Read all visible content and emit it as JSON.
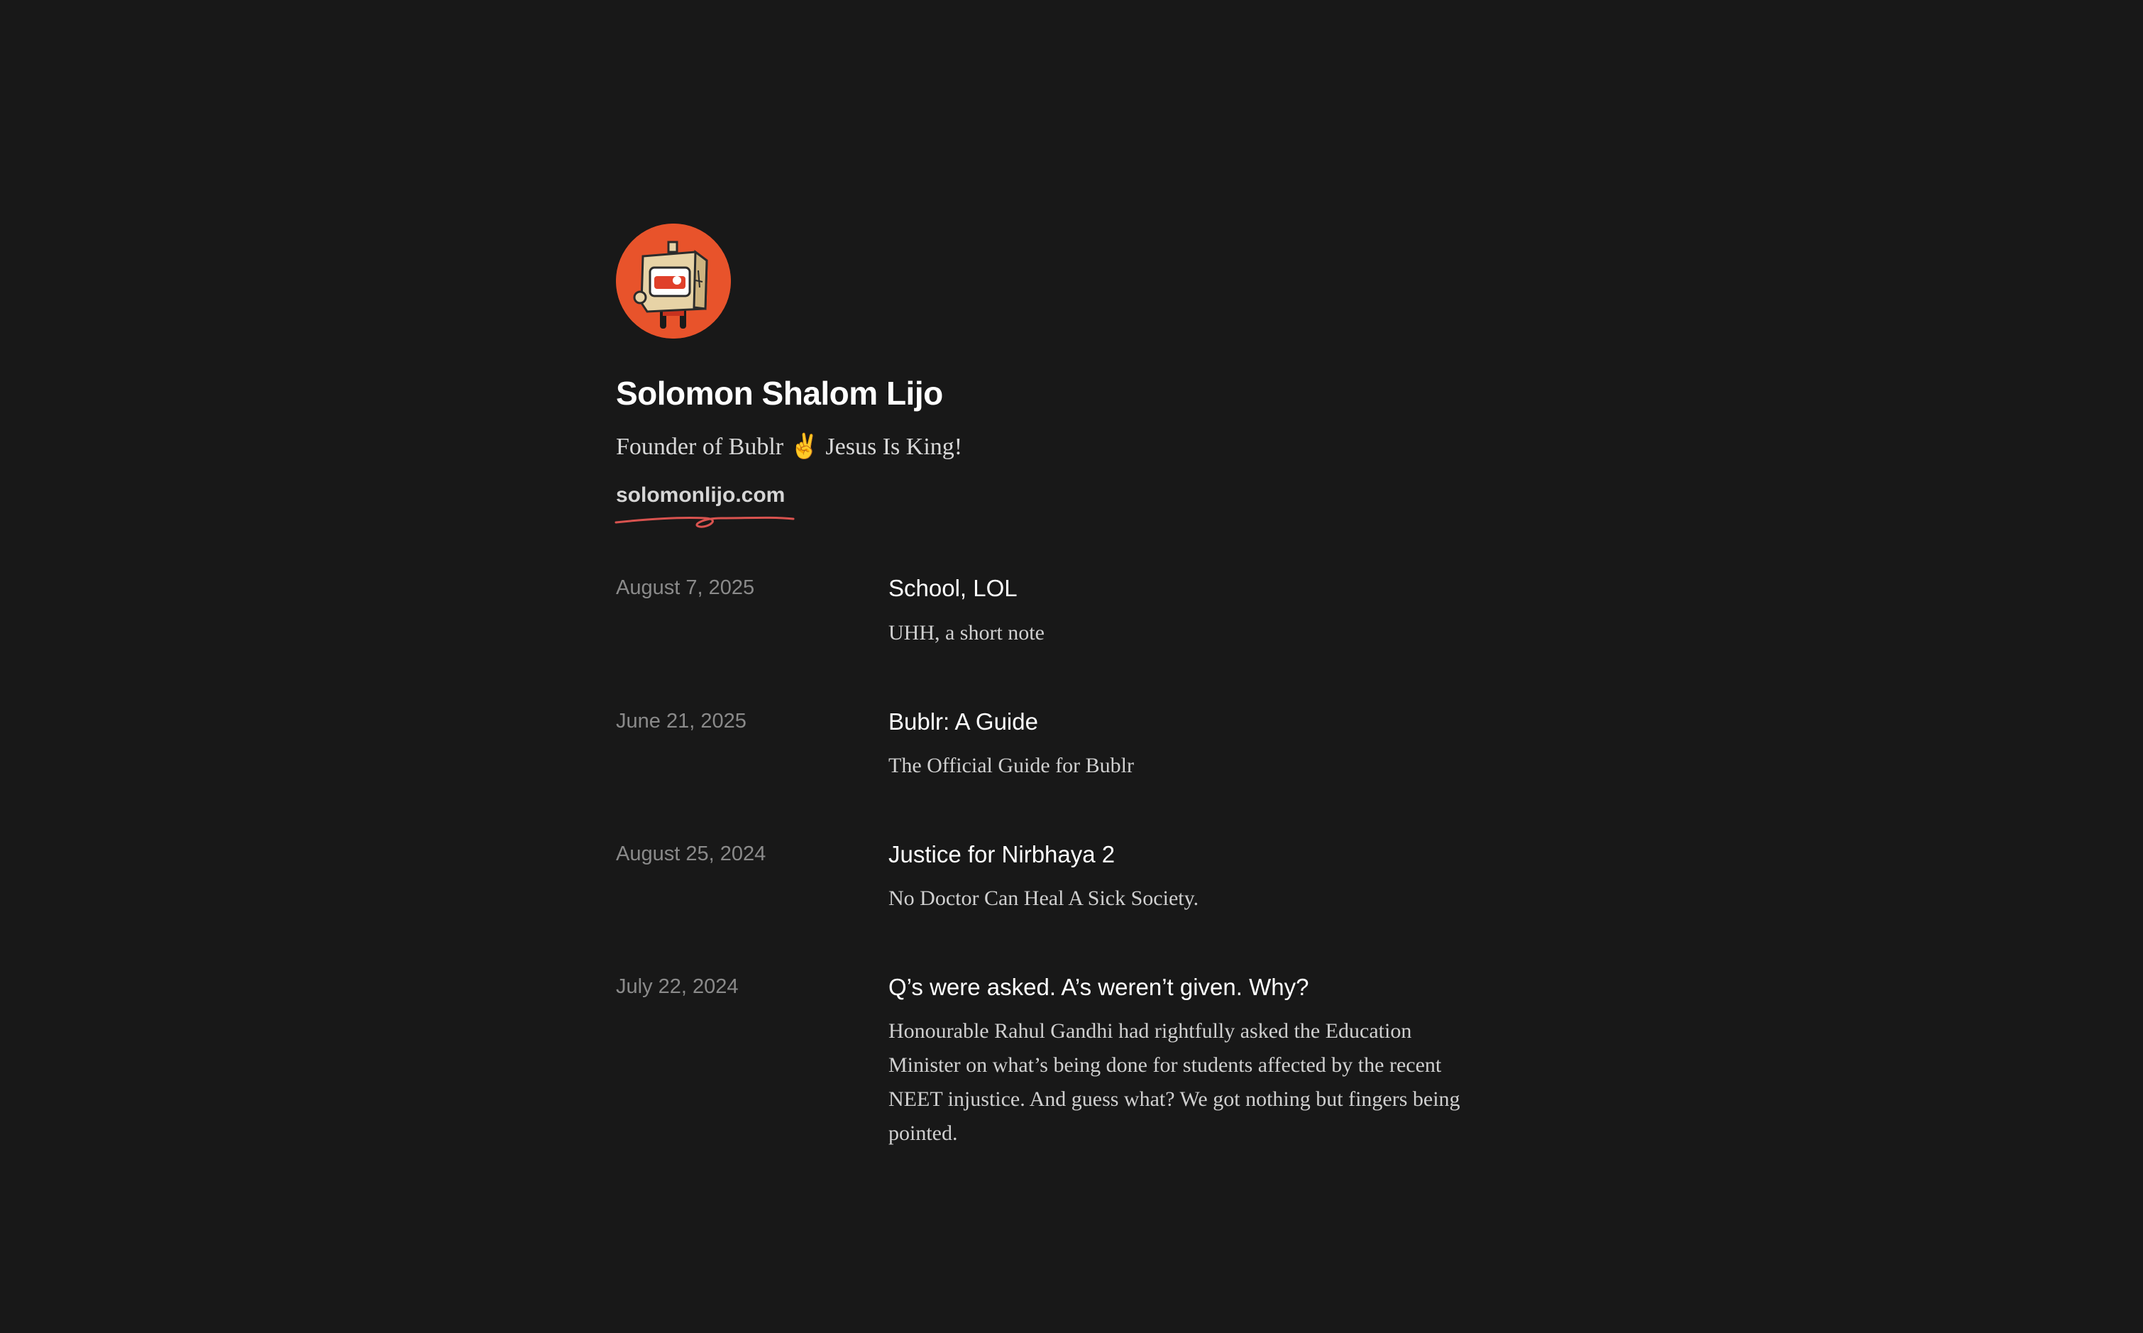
{
  "profile": {
    "name": "Solomon Shalom Lijo",
    "bio": "Founder of Bublr ✌️ Jesus Is King!",
    "website": "solomonlijo.com",
    "avatar_icon": "robot-box-avatar-icon"
  },
  "colors": {
    "background": "#181818",
    "avatar_bg": "#e8532b",
    "scribble": "#d9534f",
    "date": "#8a8a8a",
    "text": "#ffffff"
  },
  "posts": [
    {
      "date": "August 7, 2025",
      "title": "School, LOL",
      "description": "UHH, a short note"
    },
    {
      "date": "June 21, 2025",
      "title": "Bublr: A Guide",
      "description": "The Official Guide for Bublr"
    },
    {
      "date": "August 25, 2024",
      "title": "Justice for Nirbhaya 2",
      "description": "No Doctor Can Heal A Sick Society."
    },
    {
      "date": "July 22, 2024",
      "title": "Q’s were asked. A’s weren’t given. Why?",
      "description": "Honourable Rahul Gandhi had rightfully asked the Education Minister on what’s being done for students affected by the recent NEET injustice. And guess what? We got nothing but fingers being pointed."
    }
  ]
}
